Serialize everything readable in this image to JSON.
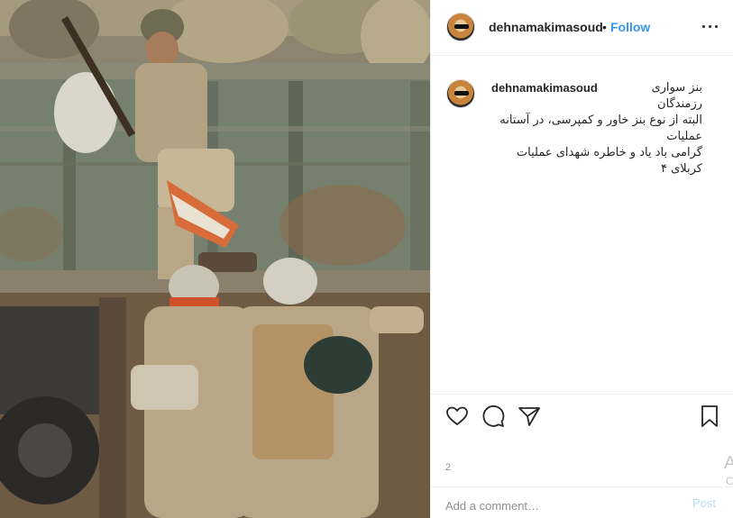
{
  "post": {
    "username": "dehnamakimasoud",
    "separator": "•",
    "follow_label": "Follow",
    "more_icon": "more-options-icon",
    "photo_description_icon": "photo",
    "caption_username": "dehnamakimasoud",
    "caption": "بنز سواری رزمندگان \nالبته از نوع بنز خاور و کمپرسی، در آستانه عملیات\nگرامی باد یاد و خاطره شهدای عملیات کربلای ۴",
    "caption_more": "",
    "actions": {
      "like_icon": "heart-icon",
      "comment_icon": "comment-icon",
      "share_icon": "share-icon",
      "save_icon": "bookmark-icon"
    },
    "likes_text": "2",
    "comment_placeholder": "Add a comment…",
    "post_label": "Post",
    "edge_glyph": "A",
    "edge_glyph2": "C",
    "colors": {
      "accent": "#3897f0",
      "post_disabled": "#b2dffc",
      "border": "#efefef"
    }
  }
}
